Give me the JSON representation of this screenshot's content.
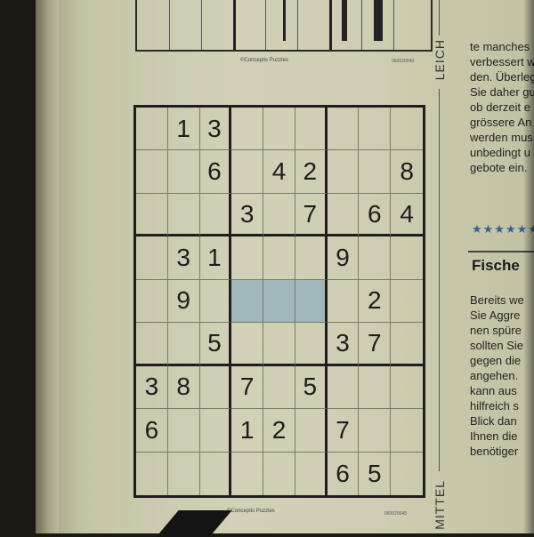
{
  "puzzle": {
    "copyright_top": "©Conceptis Puzzles",
    "code_top": "060020049",
    "copyright_bottom": "©Conceptis Puzzles",
    "code_bottom": "060020048",
    "grid": [
      [
        "",
        "1",
        "3",
        "",
        "",
        "",
        "",
        "",
        ""
      ],
      [
        "",
        "",
        "6",
        "",
        "4",
        "2",
        "",
        "",
        "8"
      ],
      [
        "",
        "",
        "",
        "3",
        "",
        "7",
        "",
        "6",
        "4"
      ],
      [
        "",
        "3",
        "1",
        "",
        "",
        "",
        "9",
        "",
        ""
      ],
      [
        "",
        "9",
        "",
        "",
        "",
        "",
        "",
        "2",
        ""
      ],
      [
        "",
        "",
        "5",
        "",
        "",
        "",
        "3",
        "7",
        ""
      ],
      [
        "3",
        "8",
        "",
        "7",
        "",
        "5",
        "",
        "",
        ""
      ],
      [
        "6",
        "",
        "",
        "1",
        "2",
        "",
        "7",
        "",
        ""
      ],
      [
        "",
        "",
        "",
        "",
        "",
        "",
        "6",
        "5",
        ""
      ]
    ],
    "highlighted_cells": [
      [
        4,
        3
      ],
      [
        4,
        4
      ],
      [
        4,
        5
      ]
    ]
  },
  "side_labels": {
    "top": "LEICH",
    "bottom": "MITTEL"
  },
  "column_text": {
    "top_lines": [
      "te manches",
      "verbessert w",
      "den. Überleg",
      "Sie daher gu",
      "ob derzeit e",
      "grössere An",
      "werden mus",
      "unbedingt u",
      "gebote ein."
    ],
    "stars": "★★★★★★",
    "heading": "Fische",
    "bottom_lines": [
      "Bereits we",
      "Sie Aggre",
      "nen spüre",
      "sollten Sie",
      "gegen die",
      "angehen.",
      "kann aus",
      "hilfreich s",
      "Blick dan",
      "Ihnen die",
      "benötiger"
    ]
  },
  "colors": {
    "highlight": "#9fb7b8",
    "stars": "#3d5f8f",
    "paper": "#d2d1b6"
  }
}
